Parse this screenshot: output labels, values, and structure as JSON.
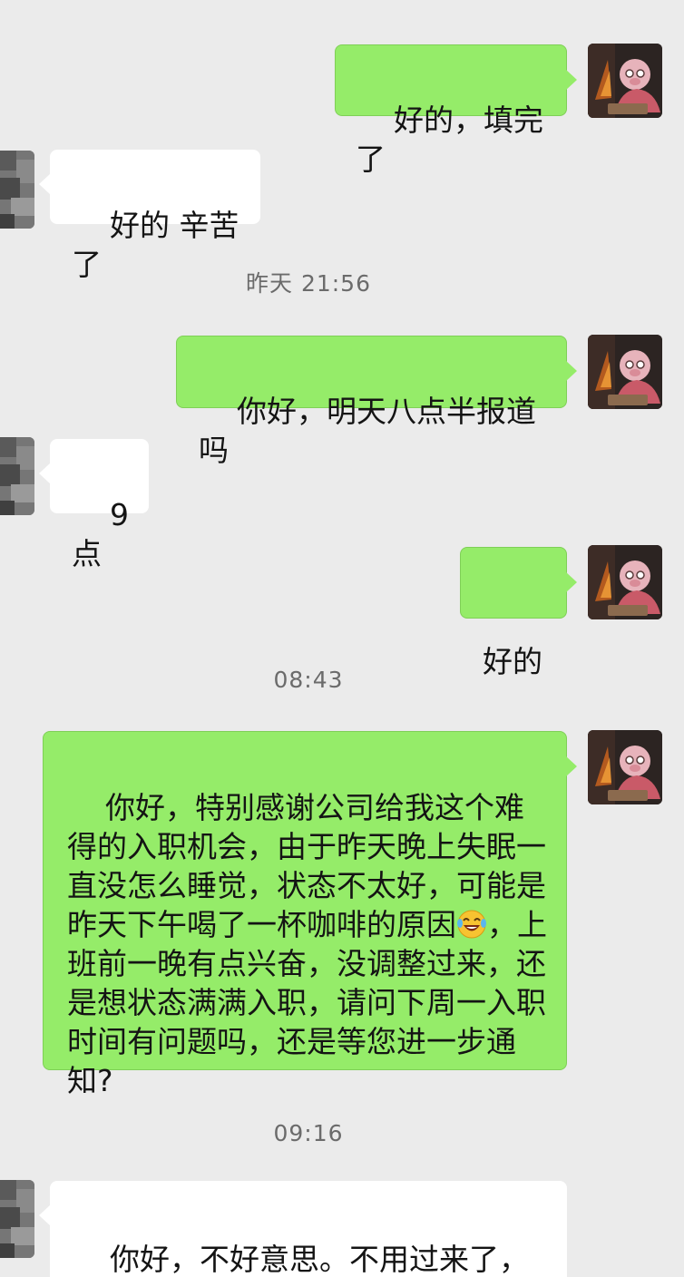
{
  "messages": {
    "m1": {
      "text": "好的，填完了"
    },
    "m2": {
      "text": "好的 辛苦了"
    },
    "m3": {
      "text": "你好，明天八点半报道吗"
    },
    "m4": {
      "text": "9点"
    },
    "m5": {
      "text": "好的"
    },
    "m6": {
      "text_before_emoji": "你好，特别感谢公司给我这个难得的入职机会，由于昨天晚上失眠一直没怎么睡觉，状态不太好，可能是昨天下午喝了一杯咖啡的原因",
      "emoji": "laughing-with-tears",
      "text_after_emoji": "，上班前一晚有点兴奋，没调整过来，还是想状态满满入职，请问下周一入职时间有问题吗，还是等您进一步通知?"
    },
    "m7": {
      "text": "你好，不好意思。不用过来了，祝找到心仪的工作。谢谢"
    }
  },
  "timestamps": {
    "t1": "昨天 21:56",
    "t2": "08:43",
    "t3": "09:16"
  },
  "colors": {
    "sent_bubble": "#95ec69",
    "received_bubble": "#ffffff",
    "background": "#ebebeb",
    "timestamp_text": "#6b6b6b"
  }
}
